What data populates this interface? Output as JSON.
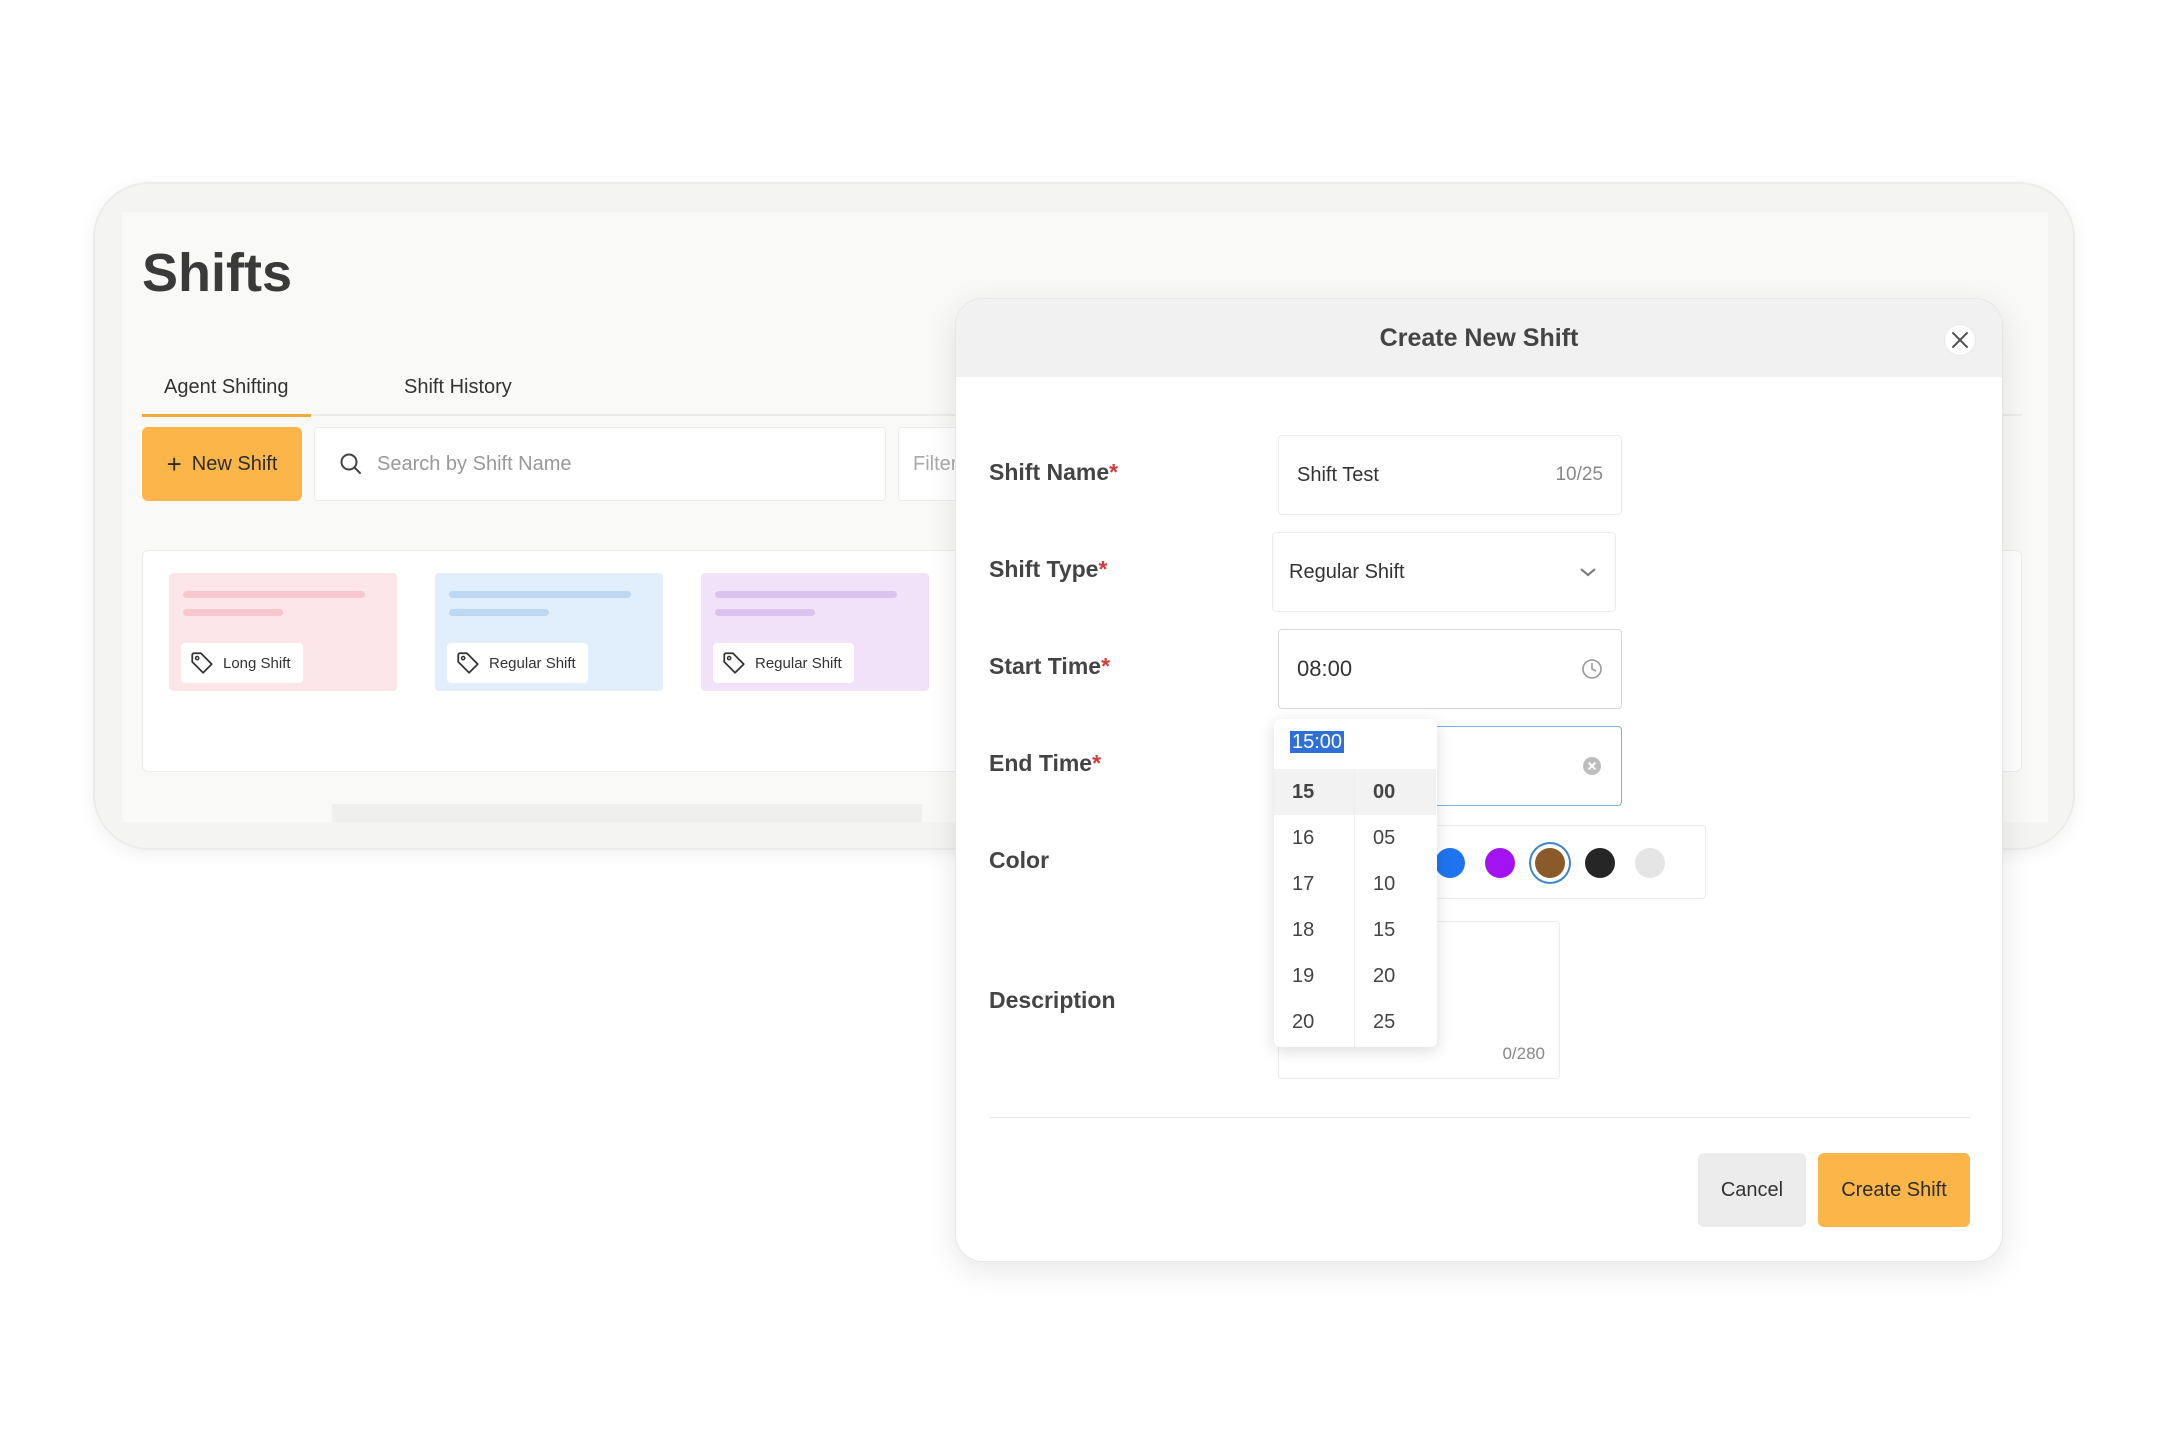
{
  "page": {
    "title": "Shifts",
    "tabs": [
      "Agent Shifting",
      "Shift History"
    ],
    "new_shift_label": "New Shift",
    "search_placeholder": "Search by Shift Name",
    "filter_label": "Filter",
    "cards": [
      {
        "tag": "Long Shift"
      },
      {
        "tag": "Regular Shift"
      },
      {
        "tag": "Regular Shift"
      }
    ]
  },
  "modal": {
    "title": "Create New Shift",
    "required_mark": "*",
    "labels": {
      "shift_name": "Shift Name",
      "shift_type": "Shift Type",
      "start_time": "Start Time",
      "end_time": "End Time",
      "color": "Color",
      "description": "Description"
    },
    "shift_name_value": "Shift Test",
    "shift_name_counter": "10/25",
    "shift_type_value": "Regular Shift",
    "start_time_value": "08:00",
    "description_counter": "0/280",
    "colors": [
      "#1f75f0",
      "#a312f0",
      "#8b5a2b",
      "#262626",
      "#e5e5e5"
    ],
    "selected_color": "#8b5a2b",
    "cancel_label": "Cancel",
    "create_label": "Create Shift"
  },
  "time_picker": {
    "current_value": "15:00",
    "hours": [
      "15",
      "16",
      "17",
      "18",
      "19",
      "20"
    ],
    "minutes": [
      "00",
      "05",
      "10",
      "15",
      "20",
      "25"
    ],
    "selected_hour": "15",
    "selected_minute": "00"
  }
}
